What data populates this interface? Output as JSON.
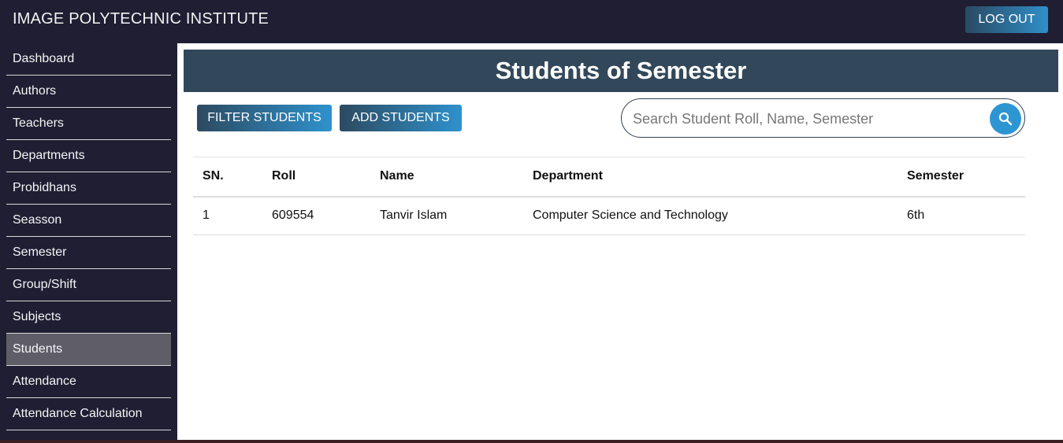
{
  "header": {
    "title": "IMAGE POLYTECHNIC INSTITUTE",
    "logout_label": "LOG OUT"
  },
  "sidebar": {
    "items": [
      {
        "label": "Dashboard"
      },
      {
        "label": "Authors"
      },
      {
        "label": "Teachers"
      },
      {
        "label": "Departments"
      },
      {
        "label": "Probidhans"
      },
      {
        "label": "Seasson"
      },
      {
        "label": "Semester"
      },
      {
        "label": "Group/Shift"
      },
      {
        "label": "Subjects"
      },
      {
        "label": "Students",
        "active": true
      },
      {
        "label": "Attendance"
      },
      {
        "label": "Attendance Calculation"
      }
    ]
  },
  "main": {
    "page_title": "Students of Semester",
    "filter_label": "FILTER STUDENTS",
    "add_label": "ADD STUDENTS",
    "search": {
      "placeholder": "Search Student Roll, Name, Semester",
      "value": "",
      "icon": "search-icon"
    },
    "table": {
      "headers": [
        "SN.",
        "Roll",
        "Name",
        "Department",
        "Semester"
      ],
      "rows": [
        [
          "1",
          "609554",
          "Tanvir Islam",
          "Computer Science and Technology",
          "6th"
        ]
      ]
    }
  },
  "colors": {
    "topbar": "#1f1e33",
    "title_bar": "#32485a",
    "accent": "#2e95d3",
    "active_nav": "#5f5e68"
  }
}
